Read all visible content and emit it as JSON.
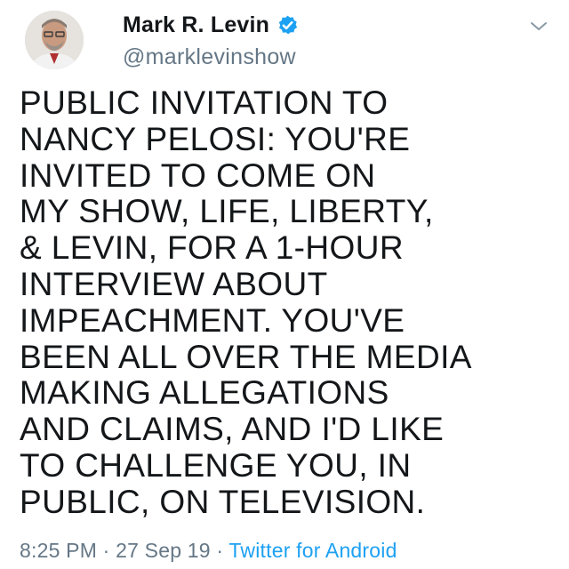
{
  "tweet": {
    "display_name": "Mark R. Levin",
    "handle": "@marklevinshow",
    "text_lines": [
      "PUBLIC INVITATION TO",
      "NANCY PELOSI: YOU'RE",
      "INVITED TO COME ON",
      "MY SHOW, LIFE, LIBERTY,",
      "& LEVIN, FOR A 1-HOUR",
      "INTERVIEW ABOUT",
      "IMPEACHMENT.  YOU'VE",
      "BEEN ALL OVER THE MEDIA",
      "MAKING ALLEGATIONS",
      "AND CLAIMS, AND I'D LIKE",
      "TO CHALLENGE YOU, IN",
      "PUBLIC, ON TELEVISION."
    ],
    "time": "8:25 PM",
    "separator": "·",
    "date": "27 Sep 19",
    "source": "Twitter for Android"
  },
  "icons": {
    "verified": "verified-badge-icon",
    "menu": "chevron-down-icon",
    "avatar": "profile-photo"
  },
  "colors": {
    "text": "#14171a",
    "secondary": "#657786",
    "link": "#1da1f2",
    "verified": "#1da1f2"
  }
}
